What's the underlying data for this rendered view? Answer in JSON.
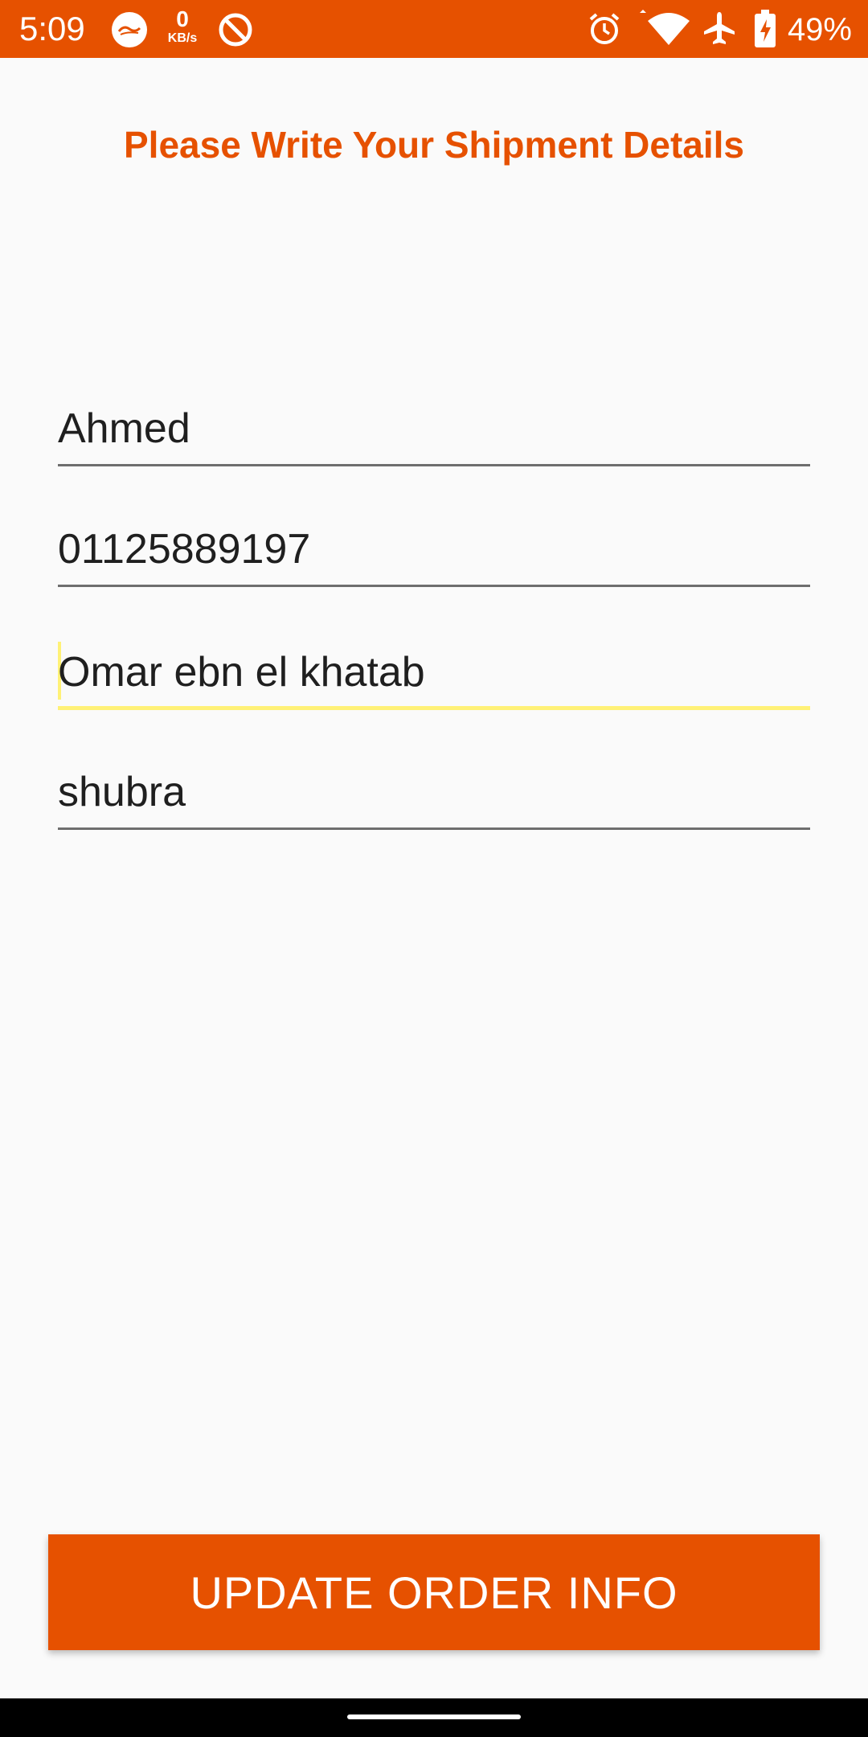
{
  "status_bar": {
    "time": "5:09",
    "net_speed_value": "0",
    "net_speed_unit": "KB/s",
    "battery": "49%",
    "icons": [
      "app-badge-icon",
      "do-not-disturb-icon",
      "alarm-icon",
      "wifi-icon",
      "airplane-icon",
      "battery-charging-icon"
    ],
    "background_color": "#e65100"
  },
  "title": "Please Write Your Shipment Details",
  "fields": [
    {
      "value": "Ahmed",
      "focused": false
    },
    {
      "value": "01125889197",
      "focused": false
    },
    {
      "value": "Omar ebn el khatab",
      "focused": true
    },
    {
      "value": "shubra",
      "focused": false
    }
  ],
  "submit_button_label": "UPDATE ORDER INFO",
  "colors": {
    "accent": "#e65100",
    "focus_underline": "#fff176",
    "background": "#fafafa"
  }
}
